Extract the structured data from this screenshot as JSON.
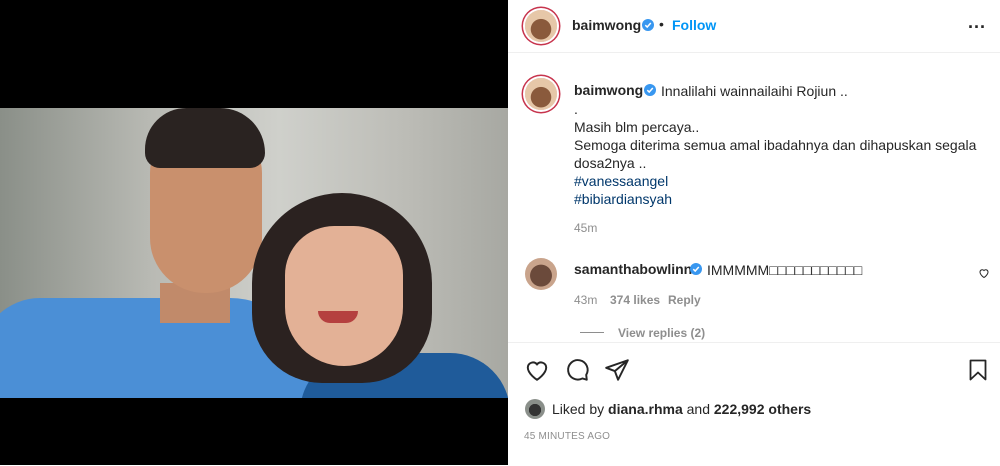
{
  "post": {
    "username": "baimwong",
    "follow_label": "Follow",
    "dot": "•",
    "more_label": "..."
  },
  "caption": {
    "username": "baimwong",
    "first_line": "Innalilahi wainnailaihi Rojiun ..",
    "lines": [
      ".",
      "Masih blm percaya..",
      "Semoga diterima semua amal ibadahnya dan dihapuskan segala",
      "dosa2nya ..",
      "#vanessaangel",
      "#bibiardiansyah"
    ],
    "time": "45m"
  },
  "comment": {
    "username": "samanthabowlinn",
    "text": "IMMMMM□□□□□□□□□□□",
    "time": "43m",
    "likes": "374 likes",
    "reply_label": "Reply",
    "view_replies": "View replies (2)"
  },
  "likes": {
    "prefix": "Liked by",
    "user": "diana.rhma",
    "middle": "and",
    "count": "222,992 others"
  },
  "timestamp": "45 MINUTES AGO",
  "icons": {
    "like": "heart-icon",
    "comment": "comment-icon",
    "share": "share-icon",
    "save": "bookmark-icon",
    "verified": "verified-badge-icon",
    "comment_like": "small-heart-icon"
  },
  "colors": {
    "accent": "#0095f6",
    "verified": "#3897f0",
    "secondary_text": "#8e8e8e"
  }
}
